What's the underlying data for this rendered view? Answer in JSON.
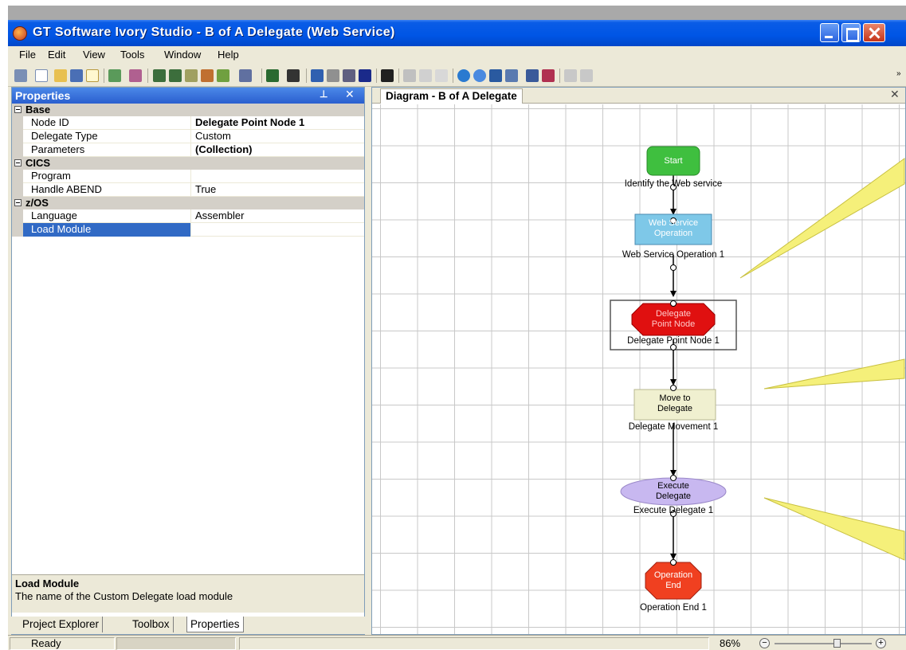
{
  "window": {
    "title": "GT Software Ivory Studio - B of A Delegate (Web Service)"
  },
  "menu": [
    "File",
    "Edit",
    "View",
    "Tools",
    "Window",
    "Help"
  ],
  "properties": {
    "header": "Properties",
    "groups": [
      {
        "name": "Base",
        "rows": [
          {
            "key": "Node ID",
            "value": "Delegate Point Node 1",
            "bold": true
          },
          {
            "key": "Delegate Type",
            "value": "Custom"
          },
          {
            "key": "Parameters",
            "value": "(Collection)",
            "bold": true
          }
        ]
      },
      {
        "name": "CICS",
        "rows": [
          {
            "key": "Program",
            "value": ""
          },
          {
            "key": "Handle ABEND",
            "value": "True"
          }
        ]
      },
      {
        "name": "z/OS",
        "rows": [
          {
            "key": "Language",
            "value": "Assembler"
          },
          {
            "key": "Load Module",
            "value": "",
            "selected": true
          }
        ]
      }
    ],
    "description": {
      "title": "Load Module",
      "text": "The name of the Custom Delegate load module"
    },
    "tabs": [
      "Project Explorer",
      "Toolbox",
      "Properties"
    ],
    "active_tab": "Properties"
  },
  "diagram": {
    "tab_label": "Diagram - B of A Delegate",
    "nodes": [
      {
        "id": "start",
        "shape": "rounded-rect",
        "text": "Start",
        "label": "Identify the Web service",
        "color": "#3fbf3f"
      },
      {
        "id": "ws-op",
        "shape": "rect",
        "text": "Web Service\nOperation",
        "label": "Web Service Operation 1",
        "color": "#7ec8e8"
      },
      {
        "id": "delegate-point",
        "shape": "octagon",
        "text": "Delegate\nPoint Node",
        "label": "Delegate Point Node 1",
        "color": "#e01010"
      },
      {
        "id": "move",
        "shape": "rect",
        "text": "Move to\nDelegate",
        "label": "Delegate Movement 1",
        "color": "#f0f0d0"
      },
      {
        "id": "execute",
        "shape": "ellipse",
        "text": "Execute\nDelegate",
        "label": "Execute Delegate 1",
        "color": "#c8b8f0"
      },
      {
        "id": "end",
        "shape": "octagon",
        "text": "Operation\nEnd",
        "label": "Operation End 1",
        "color": "#f04020"
      }
    ]
  },
  "status": {
    "text": "Ready",
    "zoom": "86%",
    "zoom_fraction": 0.65
  },
  "colors": {
    "title_bar": "#0055e5",
    "selection": "#316ac5",
    "callout": "#f5f07a"
  }
}
